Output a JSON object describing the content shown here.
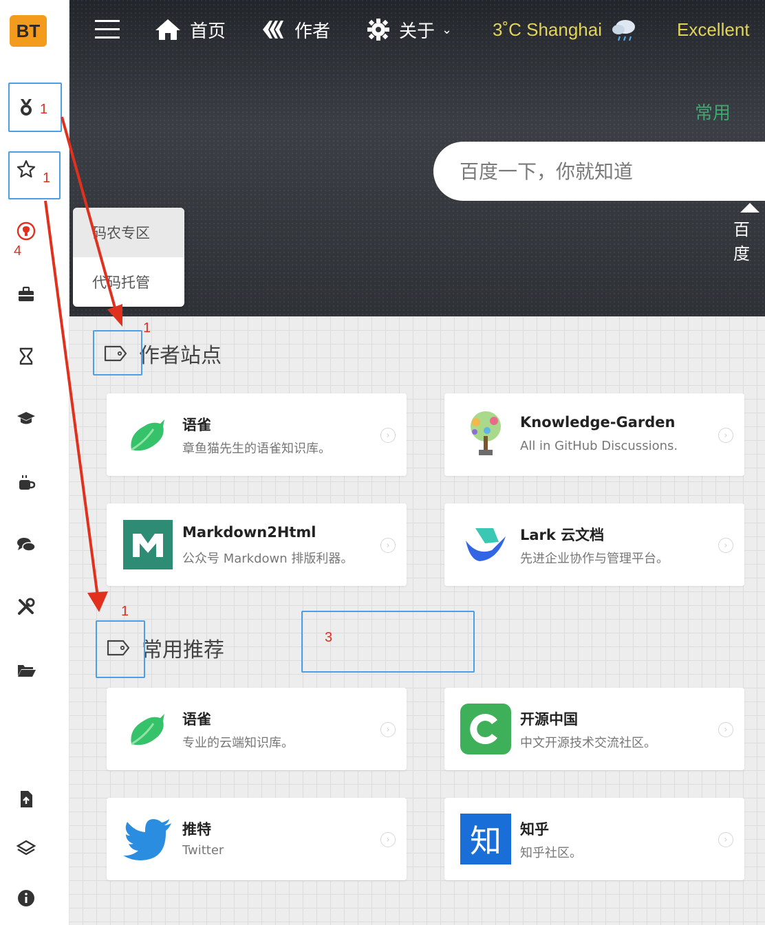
{
  "sidebar": {
    "logo": "BT",
    "icons": [
      {
        "name": "medal-icon"
      },
      {
        "name": "star-icon"
      },
      {
        "name": "github-icon"
      },
      {
        "name": "briefcase-icon"
      },
      {
        "name": "hourglass-icon"
      },
      {
        "name": "graduation-cap-icon"
      },
      {
        "name": "coffee-icon"
      },
      {
        "name": "comments-icon"
      },
      {
        "name": "tools-icon"
      },
      {
        "name": "folder-open-icon"
      },
      {
        "name": "file-upload-icon"
      },
      {
        "name": "layers-icon"
      },
      {
        "name": "info-icon"
      }
    ]
  },
  "nav": {
    "home": "首页",
    "author": "作者",
    "about": "关于",
    "about_caret": "⌄",
    "weather": "3˚C Shanghai",
    "quality": "Excellent"
  },
  "hero": {
    "tab": "常用",
    "search_placeholder": "百度一下，你就知道",
    "engine": "百度"
  },
  "popup": {
    "items": [
      "码农专区",
      "代码托管"
    ]
  },
  "sections": [
    {
      "title": "作者站点",
      "cards": [
        {
          "title": "语雀",
          "desc": "章鱼猫先生的语雀知识库。"
        },
        {
          "title": "Knowledge-Garden",
          "desc": "All in GitHub Discussions."
        },
        {
          "title": "Markdown2Html",
          "desc": "公众号 Markdown 排版利器。"
        },
        {
          "title": "Lark 云文档",
          "desc": "先进企业协作与管理平台。"
        }
      ]
    },
    {
      "title": "常用推荐",
      "cards": [
        {
          "title": "语雀",
          "desc": "专业的云端知识库。"
        },
        {
          "title": "开源中国",
          "desc": "中文开源技术交流社区。"
        },
        {
          "title": "推特",
          "desc": "Twitter"
        },
        {
          "title": "知乎",
          "desc": "知乎社区。"
        }
      ]
    }
  ],
  "thumb_text": {
    "zhihu": "知"
  },
  "annotations": {
    "labels": [
      "1",
      "1",
      "4",
      "1",
      "1",
      "3"
    ],
    "box_color": "#4a9fe6",
    "arrow_color": "#e0301e"
  },
  "colors": {
    "logo_bg": "#f39b1c",
    "weather_text": "#e2d35a",
    "tab_text": "#3ea66f"
  }
}
